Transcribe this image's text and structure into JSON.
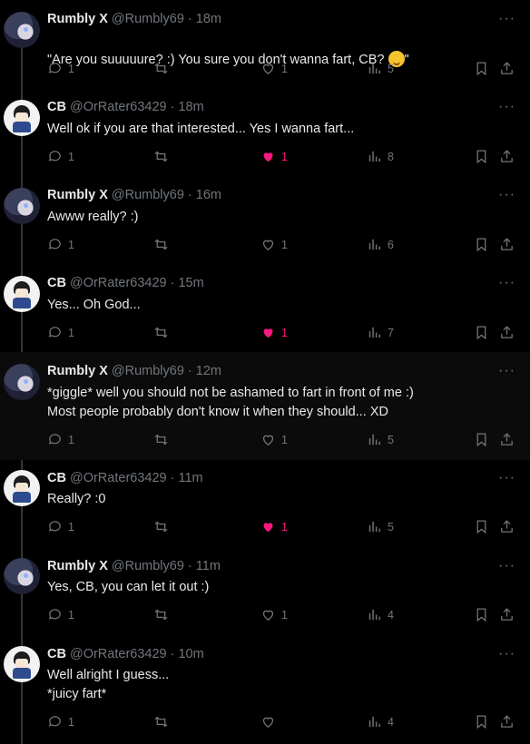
{
  "tweets": [
    {
      "name": "Rumbly X",
      "handle": "@Rumbly69",
      "time": "18m",
      "text": "\"Are you suuuuure? :) You sure you don't wanna fart, CB? ",
      "text_after": "\"",
      "avatar": "rumbly",
      "replies": "1",
      "likes": "1",
      "views": "5",
      "liked": false
    },
    {
      "name": "CB",
      "handle": "@OrRater63429",
      "time": "18m",
      "text": "Well ok if you are that interested... Yes I wanna fart...",
      "avatar": "cb",
      "replies": "1",
      "likes": "1",
      "views": "8",
      "liked": true
    },
    {
      "name": "Rumbly X",
      "handle": "@Rumbly69",
      "time": "16m",
      "text": "Awww really? :)",
      "avatar": "rumbly",
      "replies": "1",
      "likes": "1",
      "views": "6",
      "liked": false
    },
    {
      "name": "CB",
      "handle": "@OrRater63429",
      "time": "15m",
      "text": "Yes... Oh God...",
      "avatar": "cb",
      "replies": "1",
      "likes": "1",
      "views": "7",
      "liked": true
    },
    {
      "name": "Rumbly X",
      "handle": "@Rumbly69",
      "time": "12m",
      "text": "*giggle* well you should not be ashamed to fart in front of me :)\nMost people probably don't know it when they should... XD",
      "avatar": "rumbly",
      "replies": "1",
      "likes": "1",
      "views": "5",
      "liked": false,
      "highlighted": true
    },
    {
      "name": "CB",
      "handle": "@OrRater63429",
      "time": "11m",
      "text": "Really? :0",
      "avatar": "cb",
      "replies": "1",
      "likes": "1",
      "views": "5",
      "liked": true
    },
    {
      "name": "Rumbly X",
      "handle": "@Rumbly69",
      "time": "11m",
      "text": "Yes, CB, you can let it out :)",
      "avatar": "rumbly",
      "replies": "1",
      "likes": "1",
      "views": "4",
      "liked": false
    },
    {
      "name": "CB",
      "handle": "@OrRater63429",
      "time": "10m",
      "text": "Well alright I guess...\n*juicy fart*",
      "avatar": "cb",
      "replies": "1",
      "likes": "",
      "views": "4",
      "liked": false
    }
  ],
  "ui": {
    "dot": " · ",
    "more": "···"
  },
  "colors": {
    "accent_like": "#f91880",
    "muted": "#71767b",
    "text": "#e7e9ea",
    "background": "#000000"
  }
}
